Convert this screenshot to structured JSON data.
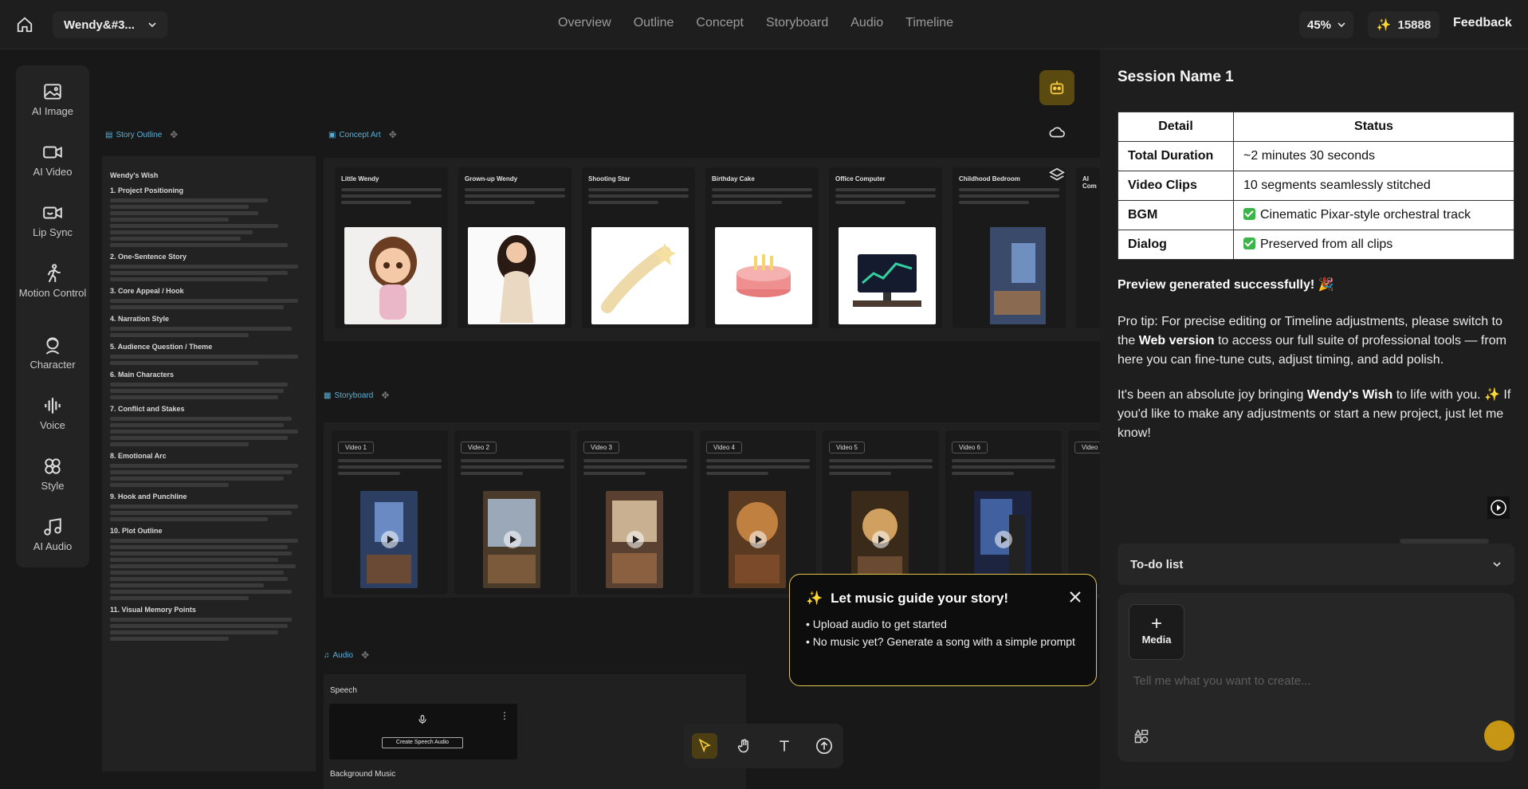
{
  "header": {
    "project_name": "Wendy&#3...",
    "tabs": [
      "Overview",
      "Outline",
      "Concept",
      "Storyboard",
      "Audio",
      "Timeline"
    ],
    "zoom": "45%",
    "credits": "15888",
    "feedback": "Feedback"
  },
  "tools": [
    {
      "label": "AI Image",
      "icon": "image-icon"
    },
    {
      "label": "AI Video",
      "icon": "video-icon"
    },
    {
      "label": "Lip Sync",
      "icon": "lip-sync-icon"
    },
    {
      "label": "Motion Control",
      "icon": "motion-icon"
    },
    {
      "label": "Character",
      "icon": "character-icon"
    },
    {
      "label": "Voice",
      "icon": "voice-icon"
    },
    {
      "label": "Style",
      "icon": "style-icon"
    },
    {
      "label": "AI Audio",
      "icon": "audio-icon"
    }
  ],
  "outline": {
    "section_label": "Story Outline",
    "title": "Wendy's Wish",
    "headings": [
      "1. Project Positioning",
      "2. One-Sentence Story",
      "3. Core Appeal / Hook",
      "4. Narration Style",
      "5. Audience Question / Theme",
      "6. Main Characters",
      "7. Conflict and Stakes",
      "8. Emotional Arc",
      "9. Hook and Punchline",
      "10. Plot Outline",
      "11. Visual Memory Points"
    ]
  },
  "concept": {
    "section_label": "Concept Art",
    "cards": [
      "Little Wendy",
      "Grown-up Wendy",
      "Shooting Star",
      "Birthday Cake",
      "Office Computer",
      "Childhood Bedroom",
      "AI Com"
    ]
  },
  "storyboard": {
    "section_label": "Storyboard",
    "videos": [
      "Video 1",
      "Video 2",
      "Video 3",
      "Video 4",
      "Video 5",
      "Video 6",
      "Video"
    ]
  },
  "audio": {
    "section_label": "Audio",
    "speech_label": "Speech",
    "create_speech": "Create Speech Audio",
    "bgm_label": "Background Music"
  },
  "popup": {
    "title": "Let music guide your story!",
    "items": [
      "• Upload audio to get started",
      "• No music yet? Generate a song with a simple prompt"
    ]
  },
  "chat": {
    "session_name": "Session Name 1",
    "table": {
      "headers": [
        "Detail",
        "Status"
      ],
      "rows": [
        [
          "Total Duration",
          "~2 minutes 30 seconds"
        ],
        [
          "Video Clips",
          "10 segments seamlessly stitched"
        ],
        [
          "BGM",
          "Cinematic Pixar-style orchestral track"
        ],
        [
          "Dialog",
          "Preserved from all clips"
        ]
      ]
    },
    "success": "Preview generated successfully! 🎉",
    "tip_a": "Pro tip: For precise editing or Timeline adjustments, please switch to the ",
    "tip_b": "Web version",
    "tip_c": " to access our full suite of professional tools — from here you can fine-tune cuts, adjust timing, and add polish.",
    "joy_a": "It's been an absolute joy bringing ",
    "joy_b": "Wendy's Wish",
    "joy_c": " to life with you. ✨ If you'd like to make any adjustments or start a new project, just let me know!",
    "todo": "To-do list",
    "media": "Media",
    "placeholder": "Tell me what you want to create..."
  },
  "colors": {
    "accent": "#e5c84a",
    "send": "#c79612",
    "section": "#58b0d8"
  }
}
